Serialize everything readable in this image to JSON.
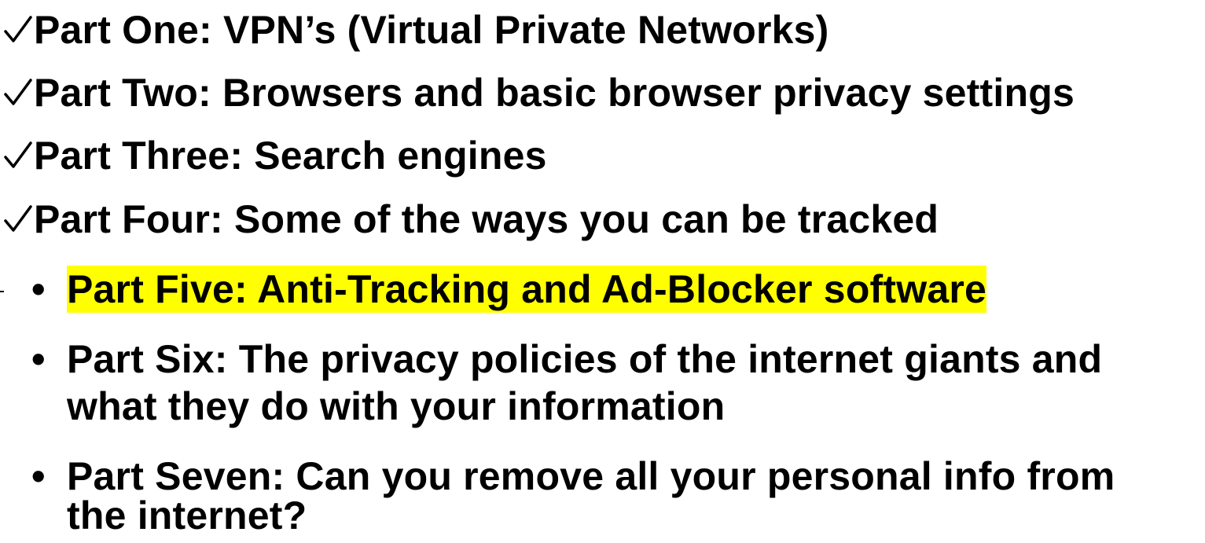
{
  "slide": {
    "colors": {
      "text": "#000000",
      "highlight": "#ffff00",
      "background": "#ffffff"
    },
    "items": [
      {
        "marker": "check-icon",
        "text": "Part One: VPN’s (Virtual Private Networks)"
      },
      {
        "marker": "check-icon",
        "text": "Part Two: Browsers and basic browser privacy settings"
      },
      {
        "marker": "check-icon",
        "text": "Part Three: Search engines"
      },
      {
        "marker": "check-icon",
        "text": "Part Four: Some of the ways you can be tracked"
      },
      {
        "marker": "bullet-icon",
        "text": "Part Five: Anti-Tracking and Ad-Blocker software",
        "highlighted": true
      },
      {
        "marker": "bullet-icon",
        "text": "Part Six: The privacy policies of the internet giants and",
        "text_line2": "what they do with your information"
      },
      {
        "marker": "bullet-icon",
        "text": "Part Seven: Can you remove all your personal info from",
        "text_line2": "the internet?"
      }
    ]
  }
}
